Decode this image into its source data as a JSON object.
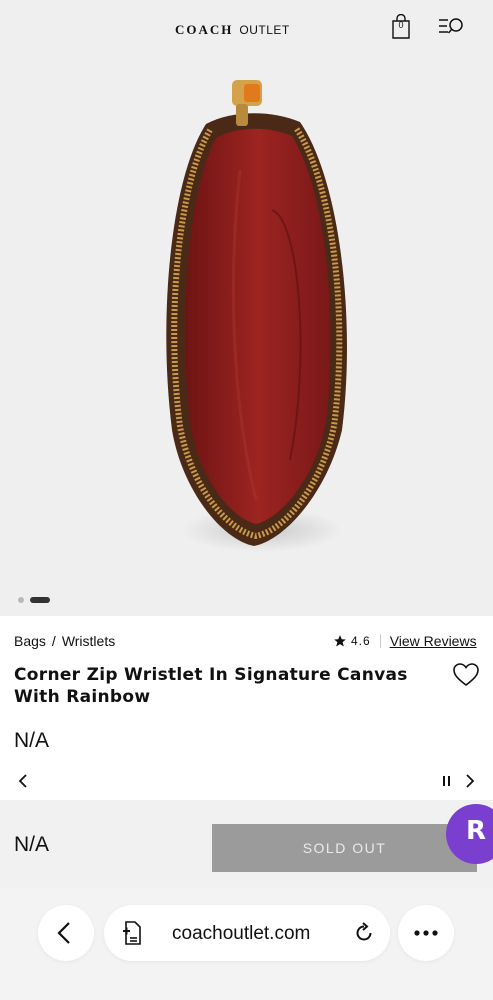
{
  "header": {
    "brand_primary": "COACH",
    "brand_secondary": "OUTLET",
    "bag_count": "0"
  },
  "gallery": {
    "image_count": 2,
    "active_index": 1
  },
  "product": {
    "breadcrumb": [
      "Bags",
      "/",
      "Wristlets"
    ],
    "rating": "4.6",
    "reviews_link": "View Reviews",
    "title": "Corner Zip Wristlet In Signature Canvas With Rainbow",
    "price": "N/A"
  },
  "buy_bar": {
    "price": "N/A",
    "button_label": "SOLD OUT"
  },
  "rakuten": {
    "letter": "R"
  },
  "browser": {
    "url": "coachoutlet.com"
  },
  "colors": {
    "hero_bg": "#efefef",
    "lining_red": "#8e1d1d",
    "zipper_gold": "#c89a4a",
    "soldout_bg": "#9b9b9b",
    "rakuten_purple": "#7b3fcf"
  }
}
